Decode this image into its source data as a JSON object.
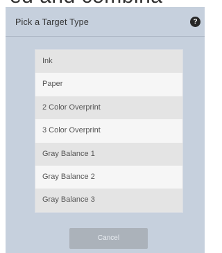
{
  "background_text": "ed and combina",
  "dialog": {
    "title": "Pick a Target Type",
    "help_icon": "?",
    "items": [
      {
        "label": "Ink"
      },
      {
        "label": "Paper"
      },
      {
        "label": "2 Color Overprint"
      },
      {
        "label": "3 Color Overprint"
      },
      {
        "label": "Gray Balance 1"
      },
      {
        "label": "Gray Balance 2"
      },
      {
        "label": "Gray Balance 3"
      }
    ],
    "cancel_label": "Cancel"
  },
  "colors": {
    "dialog_bg": "#c6d0dd",
    "button_bg": "#abb2ba"
  }
}
